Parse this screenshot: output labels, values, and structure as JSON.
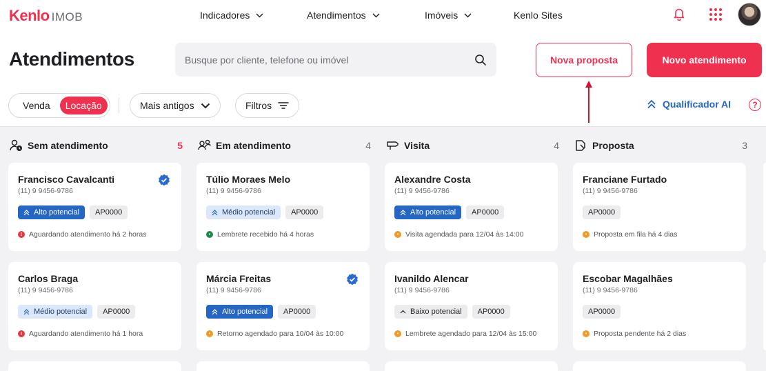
{
  "brand": {
    "name": "Kenlo",
    "product": "IMOB"
  },
  "nav": [
    {
      "label": "Indicadores",
      "dropdown": true
    },
    {
      "label": "Atendimentos",
      "dropdown": true
    },
    {
      "label": "Imóveis",
      "dropdown": true
    },
    {
      "label": "Kenlo Sites",
      "dropdown": false
    }
  ],
  "page": {
    "title": "Atendimentos"
  },
  "search": {
    "placeholder": "Busque por cliente, telefone ou imóvel"
  },
  "actions": {
    "new_proposal": "Nova proposta",
    "new_service": "Novo atendimento"
  },
  "filters": {
    "type_options": [
      "Venda",
      "Locação"
    ],
    "type_selected": "Locação",
    "sort": "Mais antigos",
    "filters_label": "Filtros",
    "qualifier": "Qualificador AI",
    "help": "?"
  },
  "colors": {
    "accent": "#f0304f",
    "blue": "#2466c4",
    "board_bg": "#f2f2f4"
  },
  "columns": [
    {
      "title": "Sem atendimento",
      "count": "5",
      "icon": "person-clock-icon",
      "cards": [
        {
          "name": "Francisco Cavalcanti",
          "phone": "(11) 9 9456-9786",
          "potential": "Alto potencial",
          "level": "alto",
          "code": "AP0000",
          "status": "Aguardando atendimento há 2 horas",
          "status_color": "red",
          "verified": true
        },
        {
          "name": "Carlos Braga",
          "phone": "(11) 9 9456-9786",
          "potential": "Médio potencial",
          "level": "medio",
          "code": "AP0000",
          "status": "Aguardando atendimento há 1 hora",
          "status_color": "red",
          "verified": false
        }
      ]
    },
    {
      "title": "Em atendimento",
      "count": "4",
      "icon": "people-icon",
      "cards": [
        {
          "name": "Túlio Moraes Melo",
          "phone": "(11) 9 9456-9786",
          "potential": "Médio potencial",
          "level": "medio",
          "code": "AP0000",
          "status": "Lembrete recebido há 4 horas",
          "status_color": "green",
          "verified": false
        },
        {
          "name": "Márcia Freitas",
          "phone": "(11) 9 9456-9786",
          "potential": "Alto potencial",
          "level": "alto",
          "code": "AP0000",
          "status": "Retorno agendado para 10/04 às 10:00",
          "status_color": "orange",
          "verified": true
        }
      ]
    },
    {
      "title": "Visita",
      "count": "4",
      "icon": "visit-icon",
      "cards": [
        {
          "name": "Alexandre Costa",
          "phone": "(11) 9 9456-9786",
          "potential": "Alto potencial",
          "level": "alto",
          "code": "AP0000",
          "status": "Visita agendada para 12/04 às 14:00",
          "status_color": "orange",
          "verified": false
        },
        {
          "name": "Ivanildo Alencar",
          "phone": "(11) 9 9456-9786",
          "potential": "Baixo potencial",
          "level": "baixo",
          "code": "AP0000",
          "status": "Lembrete agendado para 12/04 às 15:00",
          "status_color": "orange",
          "verified": false
        }
      ]
    },
    {
      "title": "Proposta",
      "count": "3",
      "icon": "proposal-icon",
      "cards": [
        {
          "name": "Franciane Furtado",
          "phone": "(11) 9 9456-9786",
          "potential": "",
          "level": "",
          "code": "AP0000",
          "status": "Proposta em fila há 4 dias",
          "status_color": "orange",
          "verified": false
        },
        {
          "name": "Escobar Magalhães",
          "phone": "(11) 9 9456-9786",
          "potential": "",
          "level": "",
          "code": "AP0000",
          "status": "Proposta pendente há 2 dias",
          "status_color": "orange",
          "verified": false
        }
      ]
    }
  ]
}
